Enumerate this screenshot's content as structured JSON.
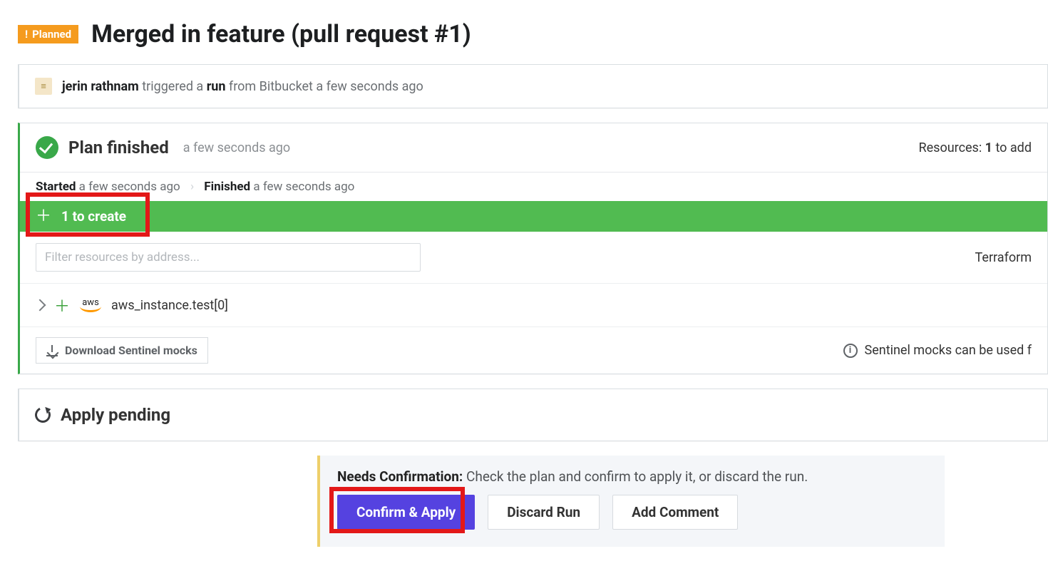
{
  "header": {
    "badge_label": "Planned",
    "title": "Merged in feature (pull request #1)"
  },
  "trigger": {
    "user": "jerin rathnam",
    "mid1": " triggered a ",
    "run_word": "run",
    "mid2": " from Bitbucket a few seconds ago"
  },
  "plan": {
    "title": "Plan finished",
    "time": "a few seconds ago",
    "right_prefix": "Resources: ",
    "right_count": "1",
    "right_suffix": " to add",
    "started_label": "Started",
    "started_time": " a few seconds ago",
    "finished_label": "Finished",
    "finished_time": " a few seconds ago",
    "create_bar": "1 to create",
    "filter_placeholder": "Filter resources by address...",
    "right_terraform": "Terraform",
    "resource_name": "aws_instance.test[0]",
    "aws_label": "aws",
    "download_btn": "Download Sentinel mocks",
    "sentinel_hint": "Sentinel mocks can be used f"
  },
  "pending": {
    "title": "Apply pending"
  },
  "confirm": {
    "needs_label": "Needs Confirmation:",
    "needs_text": " Check the plan and confirm to apply it, or discard the run.",
    "confirm_btn": "Confirm & Apply",
    "discard_btn": "Discard Run",
    "comment_btn": "Add Comment"
  }
}
